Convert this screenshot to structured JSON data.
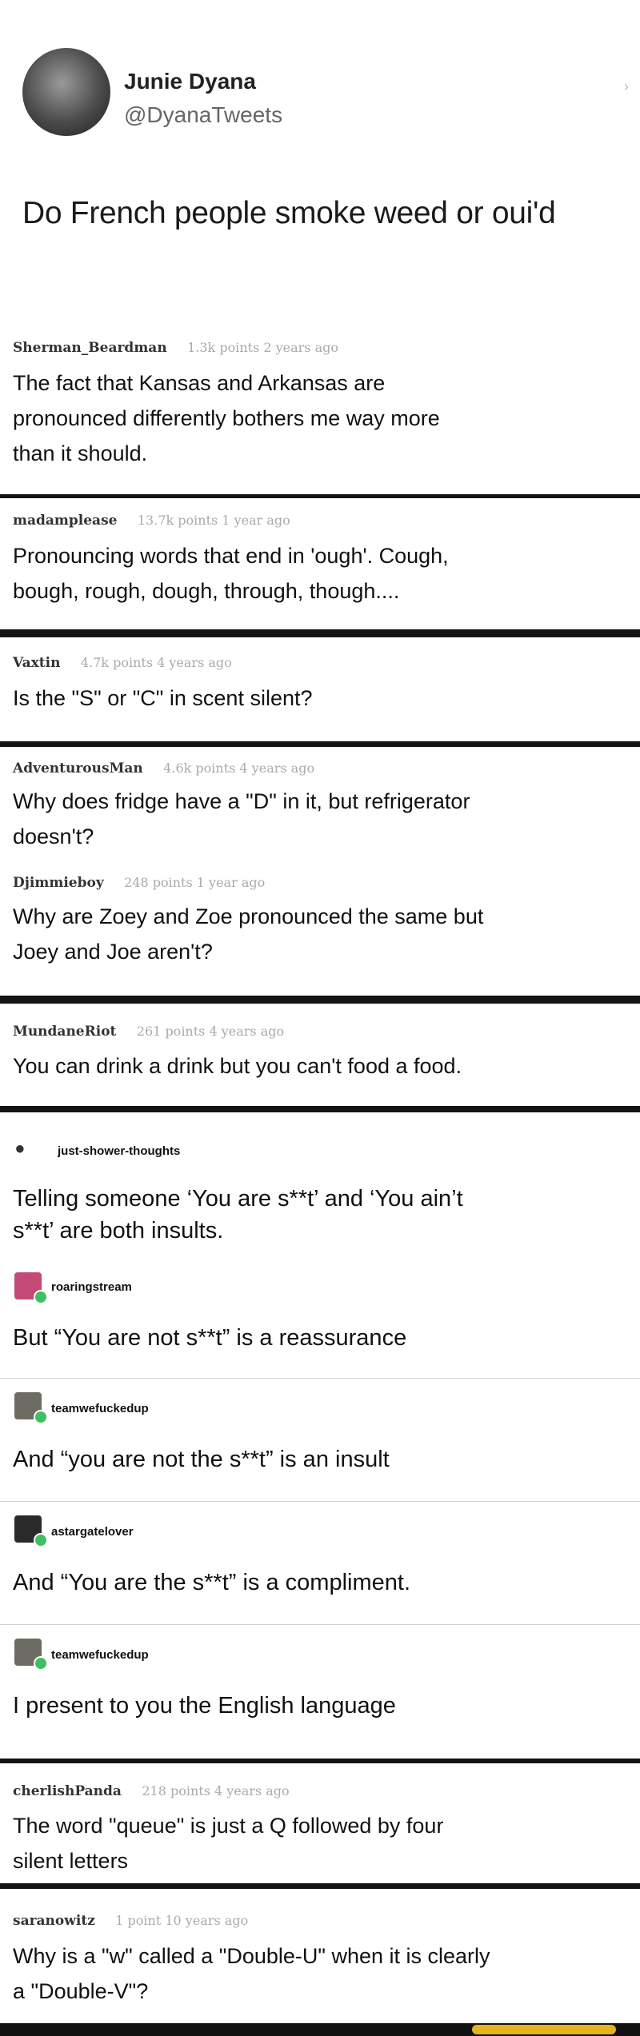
{
  "tweet": {
    "author": "Junie Dyana",
    "handle": "@DyanaTweets",
    "text": "Do French people smoke weed or oui'd"
  },
  "comments": [
    {
      "user": "Sherman_Beardman",
      "meta": "1.3k points 2 years ago",
      "lines": [
        "The fact that Kansas and Arkansas are",
        "pronounced differently bothers me way more",
        "than it should."
      ]
    },
    {
      "user": "madamplease",
      "meta": "13.7k points 1 year ago",
      "lines": [
        "Pronouncing words that end in 'ough'. Cough,",
        "bough, rough, dough, through, though...."
      ]
    },
    {
      "user": "Vaxtin",
      "meta": "4.7k points 4 years ago",
      "lines": [
        "Is the \"S\" or \"C\" in scent silent?"
      ]
    },
    {
      "user": "AdventurousMan",
      "meta": "4.6k points 4 years ago",
      "lines": [
        "Why does fridge have a \"D\" in it, but refrigerator",
        "doesn't?"
      ]
    },
    {
      "user": "Djimmieboy",
      "meta": "248 points 1 year ago",
      "lines": [
        "Why are Zoey and Zoe pronounced the same but",
        "Joey and Joe aren't?"
      ]
    },
    {
      "user": "MundaneRiot",
      "meta": "261 points 4 years ago",
      "lines": [
        "You can drink a drink but you can't food a food."
      ]
    },
    {
      "user": "cherlishPanda",
      "meta": "218 points 4 years ago",
      "lines": [
        "The word \"queue\" is just a Q followed by four",
        "silent letters"
      ]
    },
    {
      "user": "saranowitz",
      "meta": "1 point 10 years ago",
      "lines": [
        "Why is a \"w\" called a \"Double-U\" when it is clearly",
        "a \"Double-V\"?"
      ]
    }
  ],
  "tumblr": [
    {
      "user": "just-shower-thoughts",
      "lines": [
        "Telling someone ‘You are s**t’ and ‘You ain’t",
        "s**t’ are both insults."
      ]
    },
    {
      "user": "roaringstream",
      "lines": [
        "But “You are not s**t” is a reassurance"
      ]
    },
    {
      "user": "teamwefuckedup",
      "lines": [
        "And “you are not the s**t” is an insult"
      ]
    },
    {
      "user": "astargatelover",
      "lines": [
        "And “You are the s**t” is a compliment."
      ]
    },
    {
      "user": "teamwefuckedup",
      "lines": [
        "I present to you the English language"
      ]
    }
  ],
  "colors": {
    "badge": "#3fbf62",
    "separator": "#141414",
    "meta": "#aaaaaa"
  }
}
